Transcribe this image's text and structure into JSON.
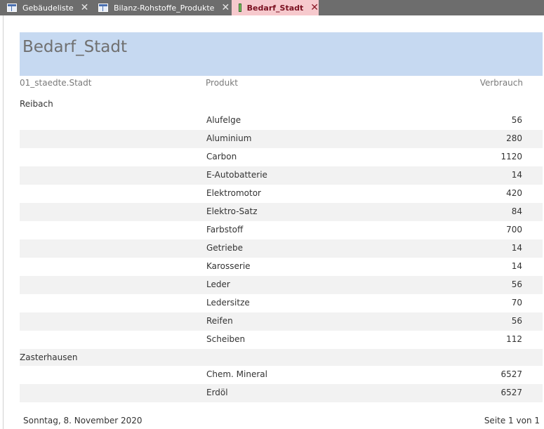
{
  "tabs": [
    {
      "label": "Gebäudeliste",
      "icon": "table-icon",
      "active": false
    },
    {
      "label": "Bilanz-Rohstoffe_Produkte",
      "icon": "table-icon",
      "active": false
    },
    {
      "label": "Bedarf_Stadt",
      "icon": "report-icon",
      "active": true
    }
  ],
  "colors": {
    "tab_strip": "#6d6d6d",
    "active_tab": "#f6c9cd",
    "header_band": "#c6d9f1",
    "alt_row": "#f2f2f2"
  },
  "report": {
    "title": "Bedarf_Stadt",
    "columns": {
      "city": "01_staedte.Stadt",
      "product": "Produkt",
      "consumption": "Verbrauch"
    },
    "groups": [
      {
        "city": "Reibach",
        "rows": [
          {
            "product": "Alufelge",
            "value": "56"
          },
          {
            "product": "Aluminium",
            "value": "280"
          },
          {
            "product": "Carbon",
            "value": "1120"
          },
          {
            "product": "E-Autobatterie",
            "value": "14"
          },
          {
            "product": "Elektromotor",
            "value": "420"
          },
          {
            "product": "Elektro-Satz",
            "value": "84"
          },
          {
            "product": "Farbstoff",
            "value": "700"
          },
          {
            "product": "Getriebe",
            "value": "14"
          },
          {
            "product": "Karosserie",
            "value": "14"
          },
          {
            "product": "Leder",
            "value": "56"
          },
          {
            "product": "Ledersitze",
            "value": "70"
          },
          {
            "product": "Reifen",
            "value": "56"
          },
          {
            "product": "Scheiben",
            "value": "112"
          }
        ]
      },
      {
        "city": "Zasterhausen",
        "rows": [
          {
            "product": "Chem. Mineral",
            "value": "6527"
          },
          {
            "product": "Erdöl",
            "value": "6527"
          }
        ]
      }
    ],
    "footer": {
      "date": "Sonntag, 8. November 2020",
      "page": "Seite 1 von 1"
    }
  }
}
